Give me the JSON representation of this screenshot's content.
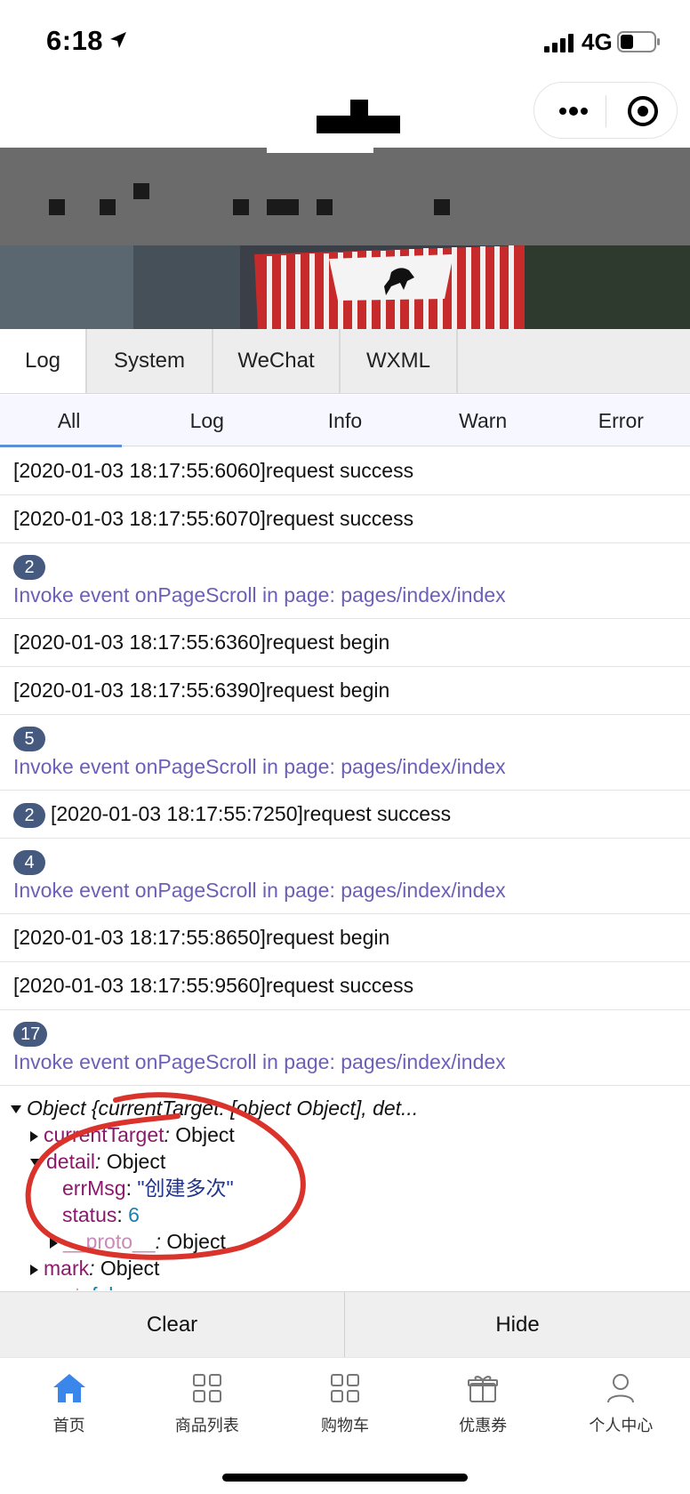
{
  "status_bar": {
    "time": "6:18",
    "network": "4G"
  },
  "tabs": [
    "Log",
    "System",
    "WeChat",
    "WXML"
  ],
  "sub_tabs": [
    "All",
    "Log",
    "Info",
    "Warn",
    "Error"
  ],
  "logs": [
    {
      "text": "[2020-01-03 18:17:55:6060]request success"
    },
    {
      "text": "[2020-01-03 18:17:55:6070]request success"
    },
    {
      "count": "2",
      "text": "Invoke event onPageScroll in page: pages/index/index"
    },
    {
      "text": "[2020-01-03 18:17:55:6360]request begin"
    },
    {
      "text": "[2020-01-03 18:17:55:6390]request begin"
    },
    {
      "count": "5",
      "text": "Invoke event onPageScroll in page: pages/index/index"
    },
    {
      "count": "2",
      "text": "[2020-01-03 18:17:55:7250]request success"
    },
    {
      "count": "4",
      "text": "Invoke event onPageScroll in page: pages/index/index"
    },
    {
      "text": "[2020-01-03 18:17:55:8650]request begin"
    },
    {
      "text": "[2020-01-03 18:17:55:9560]request success"
    },
    {
      "count": "17",
      "text": "Invoke event onPageScroll in page: pages/index/index"
    }
  ],
  "object_tree": {
    "summary": "Object {currentTarget: [object Object], det...",
    "current_target_key": "currentTarget",
    "current_target_val": "Object",
    "detail_key": "detail",
    "detail_val": "Object",
    "errmsg_key": "errMsg",
    "errmsg_val": "\"创建多次\"",
    "status_key": "status",
    "status_val": "6",
    "proto_key": "__proto__",
    "proto_val": "Object",
    "mark_key": "mark",
    "mark_val": "Object",
    "mut_key": "mut",
    "mut_val": "false"
  },
  "actions": {
    "clear": "Clear",
    "hide": "Hide"
  },
  "tabbar": [
    {
      "label": "首页",
      "icon": "home-icon"
    },
    {
      "label": "商品列表",
      "icon": "grid-icon"
    },
    {
      "label": "购物车",
      "icon": "grid-icon"
    },
    {
      "label": "优惠券",
      "icon": "gift-icon"
    },
    {
      "label": "个人中心",
      "icon": "user-icon"
    }
  ],
  "colors": {
    "badge": "#465a80",
    "system_text": "#6d5fb7",
    "tab_active": "#3b86ea",
    "annotation": "#d9332c"
  }
}
